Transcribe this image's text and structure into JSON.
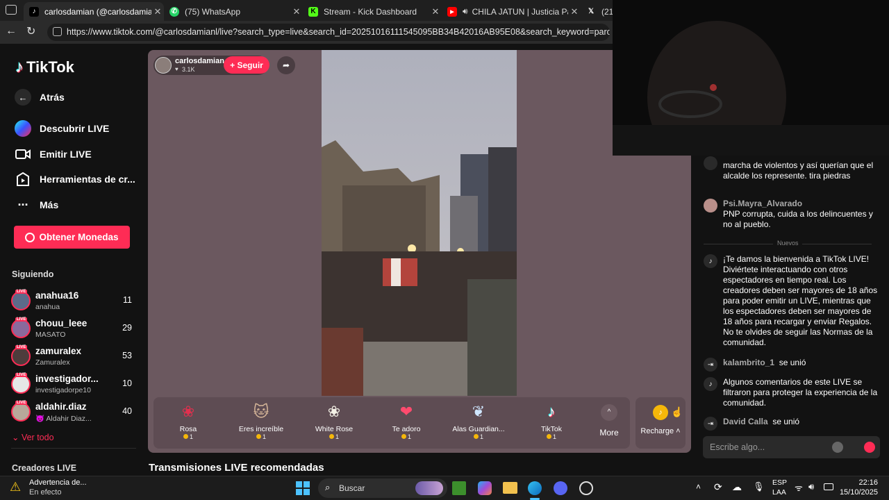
{
  "browser": {
    "tabs": [
      {
        "title": "carlosdamian (@carlosdamianl) e",
        "active": true,
        "icon": "tiktok-icon"
      },
      {
        "title": "(75) WhatsApp",
        "active": false,
        "icon": "whatsapp-icon"
      },
      {
        "title": "Stream - Kick Dashboard",
        "active": false,
        "icon": "kick-icon"
      },
      {
        "title": "CHILA JATUN | Justicia Para V",
        "active": false,
        "icon": "youtube-icon"
      },
      {
        "title": "(21) I",
        "active": false,
        "icon": "x-icon"
      }
    ],
    "url": "https://www.tiktok.com/@carlosdamianl/live?search_type=live&search_id=20251016111545095BB34B42016AB95E08&search_keyword=paro%20nacional"
  },
  "sidebar": {
    "logo": "TikTok",
    "nav": [
      {
        "label": "Atrás",
        "icon": "arrow-left-icon"
      },
      {
        "label": "Descubrir LIVE",
        "icon": "live-discover-icon"
      },
      {
        "label": "Emitir LIVE",
        "icon": "camera-icon"
      },
      {
        "label": "Herramientas de cr...",
        "icon": "tools-icon"
      },
      {
        "label": "Más",
        "icon": "more-icon"
      }
    ],
    "coins_button": "Obtener Monedas",
    "following_title": "Siguiendo",
    "following": [
      {
        "name": "anahua16",
        "sub": "anahua",
        "count": "11"
      },
      {
        "name": "chouu_leee",
        "sub": "MASATO",
        "count": "29"
      },
      {
        "name": "zamuralex",
        "sub": "Zamuralex",
        "count": "53"
      },
      {
        "name": "investigador...",
        "sub": "investigadorpe10",
        "count": "10"
      },
      {
        "name": "aldahir.diaz",
        "sub": "😈 Aldahir Diaz...",
        "count": "40"
      }
    ],
    "see_all": "Ver todo",
    "creators_title": "Creadores LIVE",
    "live_badge": "LIVE"
  },
  "live": {
    "host": "carlosdamian",
    "likes": "3.1K",
    "follow_label": "+ Seguir",
    "recommended_title": "Transmisiones LIVE recomendadas",
    "gifts": [
      {
        "name": "Rosa",
        "price": "1",
        "icon": "rose-icon"
      },
      {
        "name": "Eres increíble",
        "price": "1",
        "icon": "cat-icon"
      },
      {
        "name": "White Rose",
        "price": "1",
        "icon": "white-rose-icon"
      },
      {
        "name": "Te adoro",
        "price": "1",
        "icon": "heart-hug-icon"
      },
      {
        "name": "Alas Guardian...",
        "price": "1",
        "icon": "wings-icon"
      },
      {
        "name": "TikTok",
        "price": "1",
        "icon": "tiktok-gift-icon"
      }
    ],
    "more_label": "More",
    "recharge_label": "Recharge"
  },
  "chat": {
    "messages": [
      {
        "user": "",
        "text": "marcha de violentos y así querían que el alcalde los represente. tira piedras"
      },
      {
        "user": "Psi.Mayra_Alvarado",
        "text": "PNP corrupta, cuida a los delincuentes y no al pueblo."
      },
      {
        "user": "",
        "text": "Nuevos",
        "divider": true
      },
      {
        "user": "",
        "text": "¡Te damos la bienvenida a TikTok LIVE! Diviértete interactuando con otros espectadores en tiempo real. Los creadores deben ser mayores de 18 años para poder emitir un LIVE, mientras que los espectadores deben ser mayores de 18 años para recargar y enviar Regalos. No te olvides de seguir las Normas de la comunidad."
      },
      {
        "user": "kalambrito_1",
        "text": "se unió"
      },
      {
        "user": "",
        "text": "Algunos comentarios de este LIVE se filtraron para proteger la experiencia de la comunidad."
      },
      {
        "user": "David Calla",
        "text": "se unió"
      }
    ],
    "input_placeholder": "Escribe algo..."
  },
  "taskbar": {
    "weather_title": "Advertencia de...",
    "weather_sub": "En efecto",
    "search_label": "Buscar",
    "lang_top": "ESP",
    "lang_bottom": "LAA",
    "time": "22:16",
    "date": "15/10/2025"
  },
  "colors": {
    "accent": "#fe2c55",
    "live_bg": "#6b585f",
    "page_bg": "#121212"
  }
}
